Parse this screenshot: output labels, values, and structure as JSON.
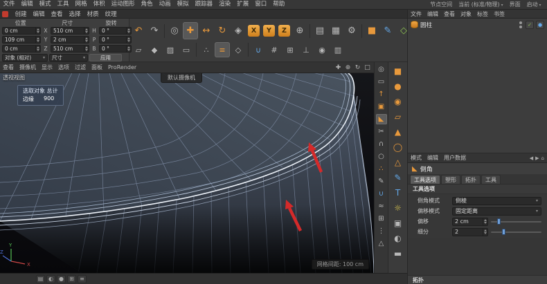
{
  "menubar": {
    "items": [
      "文件",
      "编辑",
      "模式",
      "工具",
      "网格",
      "体积",
      "运动图形",
      "角色",
      "动画",
      "模拟",
      "跟踪器",
      "渲染",
      "扩展",
      "窗口",
      "帮助"
    ],
    "right_items": [
      {
        "label": "节点空间"
      },
      {
        "label": "当前 (标准/物理)"
      },
      {
        "label": "界面"
      },
      {
        "label": "启动"
      }
    ]
  },
  "submenu": {
    "items": [
      "创建",
      "编辑",
      "查看",
      "选择",
      "材质",
      "纹理"
    ]
  },
  "coord_panel": {
    "headers": [
      "位置",
      "尺寸",
      "旋转"
    ],
    "position": [
      "0 cm",
      "109 cm",
      "0 cm"
    ],
    "pos_axes": [
      "X",
      "Y",
      "Z"
    ],
    "size": [
      "510 cm",
      "2 cm",
      "510 cm"
    ],
    "rot_axes": [
      "H",
      "P",
      "B"
    ],
    "rotation": [
      "0 °",
      "0 °",
      "0 °"
    ],
    "object_mode": "对象 (相对)",
    "size_mode": "尺寸",
    "apply_label": "应用"
  },
  "toolbar": {
    "row1": [
      {
        "name": "undo",
        "glyph": "↶"
      },
      {
        "name": "redo",
        "glyph": "↷"
      },
      {
        "name": "live-selection",
        "glyph": "◎"
      },
      {
        "name": "move-tool",
        "glyph": "✚"
      },
      {
        "name": "scale-tool",
        "glyph": "↔"
      },
      {
        "name": "rotate-tool",
        "glyph": "↻"
      },
      {
        "name": "last-tool",
        "glyph": "◈"
      },
      {
        "name": "x-axis-lock",
        "glyph": "X"
      },
      {
        "name": "y-axis-lock",
        "glyph": "Y"
      },
      {
        "name": "z-axis-lock",
        "glyph": "Z"
      },
      {
        "name": "coord-system",
        "glyph": "⊕"
      },
      {
        "name": "render-view",
        "glyph": "▤"
      },
      {
        "name": "render-picture-viewer",
        "glyph": "▦"
      },
      {
        "name": "render-settings",
        "glyph": "⚙"
      },
      {
        "name": "primitive-cube",
        "glyph": "■"
      },
      {
        "name": "spline-pen",
        "glyph": "✎"
      },
      {
        "name": "generators",
        "glyph": "◇"
      }
    ],
    "row2": [
      {
        "name": "make-editable",
        "glyph": "▱"
      },
      {
        "name": "model-mode",
        "glyph": "◆"
      },
      {
        "name": "texture-mode",
        "glyph": "▨"
      },
      {
        "name": "workplane-mode",
        "glyph": "▭"
      },
      {
        "name": "points-mode",
        "glyph": "∴"
      },
      {
        "name": "edges-mode",
        "glyph": "≡"
      },
      {
        "name": "polygons-mode",
        "glyph": "◇"
      },
      {
        "name": "snap-toggle",
        "glyph": "∪"
      },
      {
        "name": "quantize",
        "glyph": "#"
      },
      {
        "name": "mirror",
        "glyph": "⊞"
      },
      {
        "name": "axis-modify",
        "glyph": "⊥"
      },
      {
        "name": "viewport-solo",
        "glyph": "◉"
      },
      {
        "name": "display-filter",
        "glyph": "▥"
      }
    ]
  },
  "viewport": {
    "menu": [
      "查看",
      "摄像机",
      "显示",
      "选项",
      "过滤",
      "面板",
      "ProRender"
    ],
    "nav_icons": [
      {
        "name": "pan-view",
        "glyph": "✚"
      },
      {
        "name": "zoom-view",
        "glyph": "⊕"
      },
      {
        "name": "orbit-view",
        "glyph": "↻"
      },
      {
        "name": "maximize-view",
        "glyph": "□"
      }
    ],
    "view_label": "透视视图",
    "camera_label": "默认摄像机",
    "selection_tooltip": {
      "title": "选取对象 总计",
      "row_label": "边缘",
      "row_value": "900"
    },
    "grid_spacing_label": "网格间距: 100 cm"
  },
  "strip1": {
    "icons": [
      {
        "name": "select",
        "glyph": "◎"
      },
      {
        "name": "marquee-select",
        "glyph": "▭"
      },
      {
        "name": "extrude",
        "glyph": "↑"
      },
      {
        "name": "inner-extrude",
        "glyph": "▣"
      },
      {
        "name": "bevel-tool",
        "glyph": "◣"
      },
      {
        "name": "knife",
        "glyph": "✂"
      },
      {
        "name": "bridge",
        "glyph": "∩"
      },
      {
        "name": "close-hole",
        "glyph": "○"
      },
      {
        "name": "weld",
        "glyph": "∴"
      },
      {
        "name": "brush",
        "glyph": "✎"
      },
      {
        "name": "magnet",
        "glyph": "∪"
      },
      {
        "name": "smooth-shift",
        "glyph": "≈"
      },
      {
        "name": "matrix",
        "glyph": "⊞"
      },
      {
        "name": "array",
        "glyph": "⋮"
      },
      {
        "name": "optimize",
        "glyph": "△"
      }
    ]
  },
  "strip2": {
    "icons": [
      {
        "name": "cube-primitive",
        "glyph": "■"
      },
      {
        "name": "sphere-primitive",
        "glyph": "●"
      },
      {
        "name": "cylinder-primitive",
        "glyph": "◉"
      },
      {
        "name": "plane-primitive",
        "glyph": "▱"
      },
      {
        "name": "cone-primitive",
        "glyph": "▲"
      },
      {
        "name": "torus-primitive",
        "glyph": "◯"
      },
      {
        "name": "pyramid-primitive",
        "glyph": "△"
      },
      {
        "name": "spline-pen",
        "glyph": "✎"
      },
      {
        "name": "text-spline",
        "glyph": "T"
      },
      {
        "name": "light",
        "glyph": "☼"
      },
      {
        "name": "camera",
        "glyph": "▣"
      },
      {
        "name": "sky",
        "glyph": "◐"
      },
      {
        "name": "floor",
        "glyph": "▬"
      }
    ]
  },
  "object_panel": {
    "menu": [
      "文件",
      "编辑",
      "查看",
      "对象",
      "标签",
      "书签"
    ],
    "object": {
      "name": "圆柱"
    },
    "tags": [
      {
        "name": "visible-tag",
        "glyph": "✓"
      },
      {
        "name": "phong-tag",
        "glyph": "●"
      }
    ]
  },
  "attributes": {
    "menu": [
      "模式",
      "编辑",
      "用户数据"
    ],
    "history_icons": [
      {
        "name": "back",
        "glyph": "◀"
      },
      {
        "name": "forward",
        "glyph": "▶"
      },
      {
        "name": "home",
        "glyph": "⌂"
      }
    ],
    "title": "倒角",
    "tabs": [
      "工具选项",
      "塑形",
      "拓扑",
      "工具"
    ],
    "section": "工具选项",
    "fields": [
      {
        "label": "倒角模式",
        "value": "倒棱"
      },
      {
        "label": "偏移模式",
        "value": "固定距离"
      },
      {
        "label": "偏移",
        "value": "2 cm"
      },
      {
        "label": "细分",
        "value": "2"
      }
    ],
    "bottom_section": "拓扑"
  },
  "statusbar": {
    "icons": [
      {
        "name": "timeline",
        "glyph": "▤"
      },
      {
        "name": "materials",
        "glyph": "◐"
      },
      {
        "name": "material-preview",
        "glyph": "●"
      },
      {
        "name": "coordinates",
        "glyph": "⊞"
      },
      {
        "name": "layers",
        "glyph": "≡"
      }
    ]
  }
}
